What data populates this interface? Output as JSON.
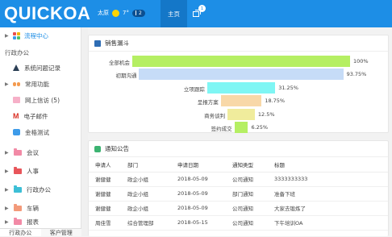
{
  "header": {
    "logo": "QUICKOA",
    "city": "太原",
    "temp": "7°",
    "aqi": "2",
    "home_label": "主页",
    "window_badge": "1"
  },
  "sidebar": {
    "top_item": "流程中心",
    "section": "行政办公",
    "sub_items": [
      {
        "label": "系统问题记录",
        "icon": "warning-icon"
      },
      {
        "label": "常用功能",
        "icon": "users-icon"
      },
      {
        "label": "网上信访 (5)",
        "icon": "mailbox-icon"
      },
      {
        "label": "电子邮件",
        "icon": "gmail-icon"
      },
      {
        "label": "金格测试",
        "icon": "app-icon"
      }
    ],
    "folders": [
      "会议",
      "人事",
      "行政办公",
      "车辆",
      "报表"
    ],
    "tabs": [
      "行政办公",
      "客户管理"
    ]
  },
  "sales_panel": {
    "title": "销售漏斗"
  },
  "chart_data": {
    "type": "funnel",
    "title": "",
    "categories": [
      "全部机会",
      "初期沟通",
      "立项跟踪",
      "呈报方案",
      "商务谈判",
      "签约成交"
    ],
    "values": [
      100,
      93.75,
      31.25,
      18.75,
      12.5,
      6.25
    ],
    "labels": [
      "100%",
      "93.75%",
      "31.25%",
      "18.75%",
      "12.5%",
      "6.25%"
    ],
    "colors": [
      "#b5ef63",
      "#c6dcf7",
      "#7ff6f4",
      "#f8d8a8",
      "#f0ec9c",
      "#b5ef63"
    ]
  },
  "notice_panel": {
    "title": "通知公告",
    "columns": [
      "申请人",
      "部门",
      "申请日期",
      "通知类型",
      "标题"
    ],
    "rows": [
      [
        "谢健健",
        "政企小组",
        "2018-05-09",
        "公司通知",
        "3333333333"
      ],
      [
        "谢健健",
        "政企小组",
        "2018-05-09",
        "部门通知",
        "准备下班"
      ],
      [
        "谢健健",
        "政企小组",
        "2018-05-09",
        "公司通知",
        "大家去锻炼了"
      ],
      [
        "周佳雪",
        "综合管理部",
        "2018-05-15",
        "公司通知",
        "下午培训OA"
      ]
    ]
  }
}
